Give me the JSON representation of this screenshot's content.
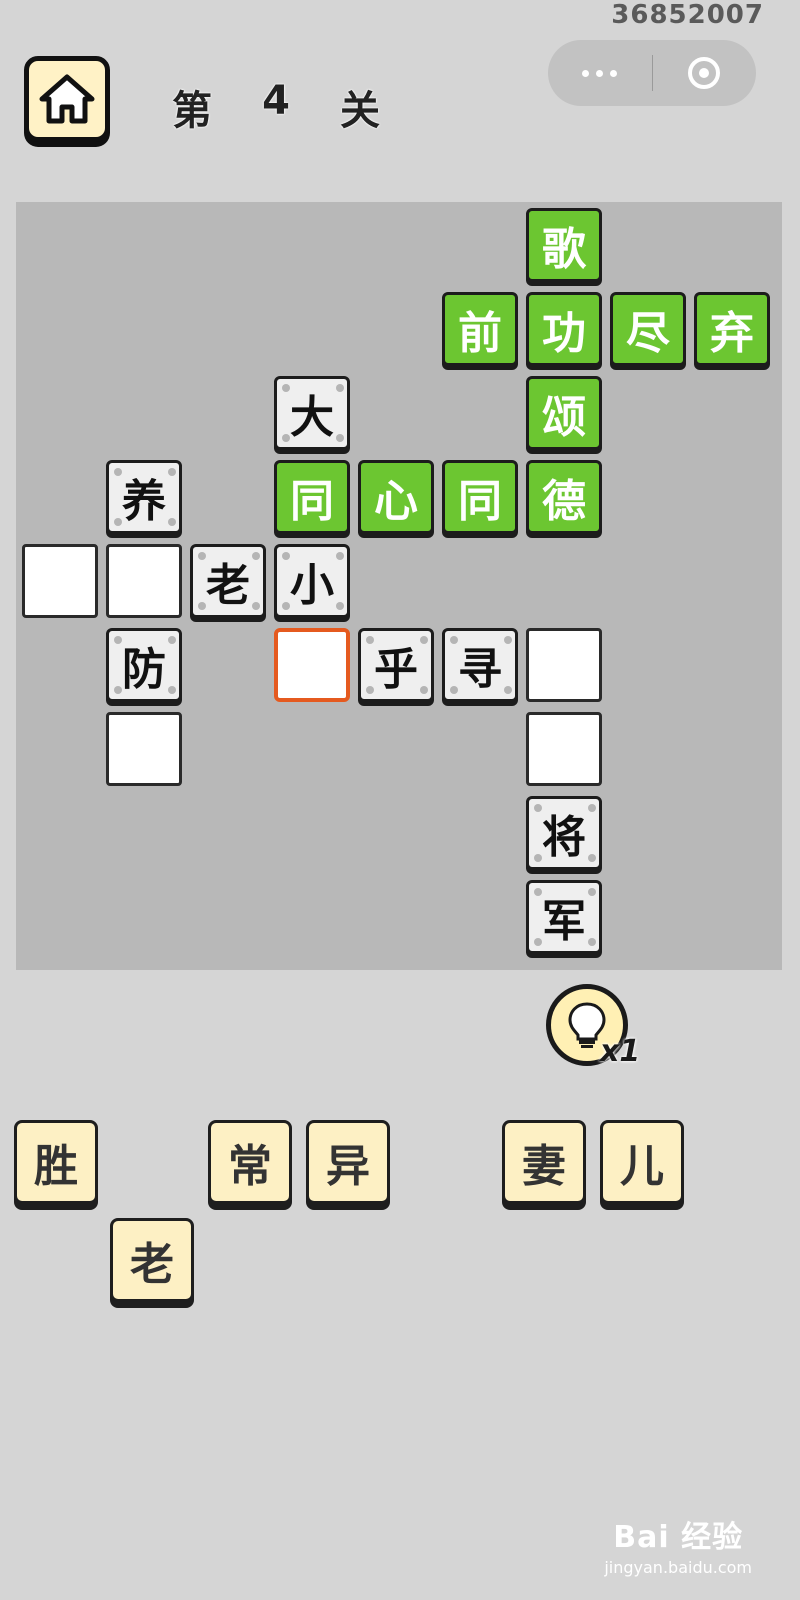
{
  "top_id": "36852007",
  "header": {
    "level_parts": [
      "第",
      "4",
      "关"
    ]
  },
  "board": {
    "cells": [
      {
        "id": "r0c6",
        "type": "green",
        "char": "歌"
      },
      {
        "id": "r1c5",
        "type": "green",
        "char": "前"
      },
      {
        "id": "r1c6",
        "type": "green",
        "char": "功"
      },
      {
        "id": "r1c7",
        "type": "green",
        "char": "尽"
      },
      {
        "id": "r1c8",
        "type": "green",
        "char": "弃"
      },
      {
        "id": "r2c3",
        "type": "given",
        "char": "大"
      },
      {
        "id": "r2c6",
        "type": "green",
        "char": "颂"
      },
      {
        "id": "r3c1",
        "type": "given",
        "char": "养"
      },
      {
        "id": "r3c3",
        "type": "green",
        "char": "同"
      },
      {
        "id": "r3c4",
        "type": "green",
        "char": "心"
      },
      {
        "id": "r3c5",
        "type": "green",
        "char": "同"
      },
      {
        "id": "r3c6",
        "type": "green",
        "char": "德"
      },
      {
        "id": "r4c0",
        "type": "empty",
        "char": ""
      },
      {
        "id": "r4c1",
        "type": "empty",
        "char": ""
      },
      {
        "id": "r4c2",
        "type": "given",
        "char": "老"
      },
      {
        "id": "r4c3",
        "type": "given",
        "char": "小"
      },
      {
        "id": "r5c1",
        "type": "given",
        "char": "防"
      },
      {
        "id": "r5c3",
        "type": "selected",
        "char": ""
      },
      {
        "id": "r5c4",
        "type": "given",
        "char": "乎"
      },
      {
        "id": "r5c5",
        "type": "given",
        "char": "寻"
      },
      {
        "id": "r5c6",
        "type": "empty",
        "char": ""
      },
      {
        "id": "r6c1",
        "type": "empty",
        "char": ""
      },
      {
        "id": "r6c6",
        "type": "empty",
        "char": ""
      },
      {
        "id": "r7c6",
        "type": "given",
        "char": "将"
      },
      {
        "id": "r8c6",
        "type": "given",
        "char": "军"
      }
    ]
  },
  "hint": {
    "count": "x1"
  },
  "choices": [
    "胜",
    "常",
    "异",
    "妻",
    "儿",
    "老"
  ],
  "watermark": {
    "main": "Bai 经验",
    "sub": "jingyan.baidu.com"
  }
}
